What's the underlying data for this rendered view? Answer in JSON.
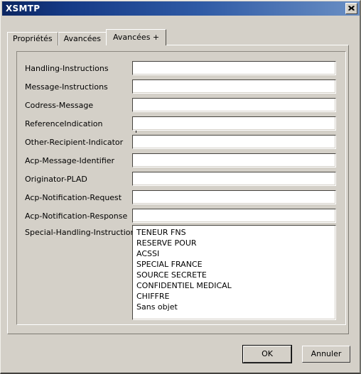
{
  "window": {
    "title": "XSMTP",
    "close_icon": "close-icon",
    "close_label": "X"
  },
  "tabs": [
    {
      "label": "Propriétés",
      "selected": false
    },
    {
      "label": "Avancées",
      "selected": false
    },
    {
      "label": "Avancées +",
      "selected": true
    }
  ],
  "form": {
    "fields": [
      {
        "label": "Handling-Instructions",
        "value": "",
        "focused": true
      },
      {
        "label": "Message-Instructions",
        "value": "",
        "focused": false
      },
      {
        "label": "Codress-Message",
        "value": "",
        "focused": false
      },
      {
        "label": "ReferenceIndication",
        "value": "",
        "focused": false
      },
      {
        "label": "Other-Recipient-Indicator",
        "value": "",
        "focused": false
      },
      {
        "label": "Acp-Message-Identifier",
        "value": "",
        "focused": false
      },
      {
        "label": "Originator-PLAD",
        "value": "",
        "focused": false
      },
      {
        "label": "Acp-Notification-Request",
        "value": "",
        "focused": false
      },
      {
        "label": "Acp-Notification-Response",
        "value": "",
        "focused": false
      }
    ],
    "list_field": {
      "label": "Special-Handling-Instructions",
      "items": [
        "TENEUR FNS",
        "RESERVE POUR",
        "ACSSI",
        "SPECIAL FRANCE",
        "SOURCE SECRETE",
        "CONFIDENTIEL MEDICAL",
        "CHIFFRE",
        "Sans objet"
      ]
    }
  },
  "buttons": {
    "ok": "OK",
    "cancel": "Annuler"
  },
  "colors": {
    "dialog_face": "#d4d0c8",
    "titlebar_start": "#0b2560",
    "titlebar_end": "#6a8fc4",
    "field_bg": "#ffffff",
    "text": "#000000"
  }
}
